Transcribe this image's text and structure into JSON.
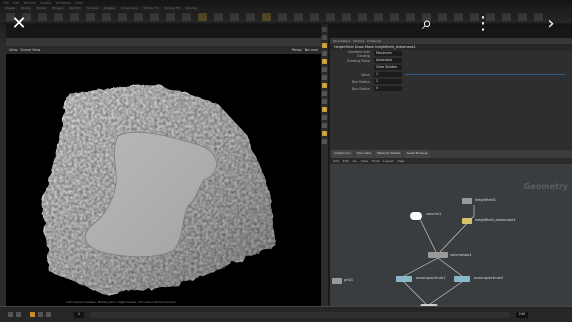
{
  "menubar": [
    "File",
    "Edit",
    "Render",
    "Assets",
    "Windows",
    "Help"
  ],
  "shelf": {
    "tabs": [
      "Create",
      "Modify",
      "Model",
      "Polygon",
      "Deform",
      "Texture",
      "Rigging",
      "Characters",
      "Terrain FX",
      "Simple FX",
      "Volume"
    ]
  },
  "viewport": {
    "pane_label": "Scene View",
    "tab_label": "View",
    "camera_menu": "Persp",
    "view_menu": "No cam",
    "footer_text": "Left mouse tumbles. Middle pans. Right dollies. Ctrl+Alt+Left box-zooms."
  },
  "params": {
    "node_title": "HeightField Draw Mask  heightfield_drawmask1",
    "tabs": [
      "Parameters",
      "Strokes",
      "Drawings"
    ],
    "rows": [
      {
        "label": "Combine with Existing",
        "value": "Maximum"
      },
      {
        "label": "Drawing Plane",
        "value": "Automatic"
      },
      {
        "label": "",
        "value": "Clear Strokes"
      },
      {
        "label": "Value",
        "value": "1"
      },
      {
        "label": "Blur Radius",
        "value": "1"
      },
      {
        "label": "Blur Radius",
        "value": "0"
      }
    ]
  },
  "network": {
    "tabs": [
      "/obj/terrain",
      "Tree View",
      "Material Palette",
      "Asset Browser"
    ],
    "menu": [
      "Add",
      "Edit",
      "Go",
      "View",
      "Tools",
      "Layout",
      "Help"
    ],
    "watermark": "Geometry",
    "nodes": [
      {
        "name": "heightfield1",
        "color": "#9a9a9a"
      },
      {
        "name": "volume1",
        "color": "#ffffff"
      },
      {
        "name": "heightfield_drawmask1",
        "color": "#d6c46a"
      },
      {
        "name": "volumevop1",
        "color": "#9a9a9a"
      },
      {
        "name": "oceanspectrum1",
        "color": "#8ab8c8"
      },
      {
        "name": "oceanspectrum2",
        "color": "#8ab8c8"
      },
      {
        "name": "grid1",
        "color": "#9a9a9a"
      }
    ]
  },
  "timeline": {
    "frame": "1",
    "start": "1",
    "end": "240"
  },
  "overlay": {
    "close_glyph": "✕",
    "lens_glyph": "⌕",
    "more_glyph": "⋮",
    "next_glyph": "›"
  }
}
